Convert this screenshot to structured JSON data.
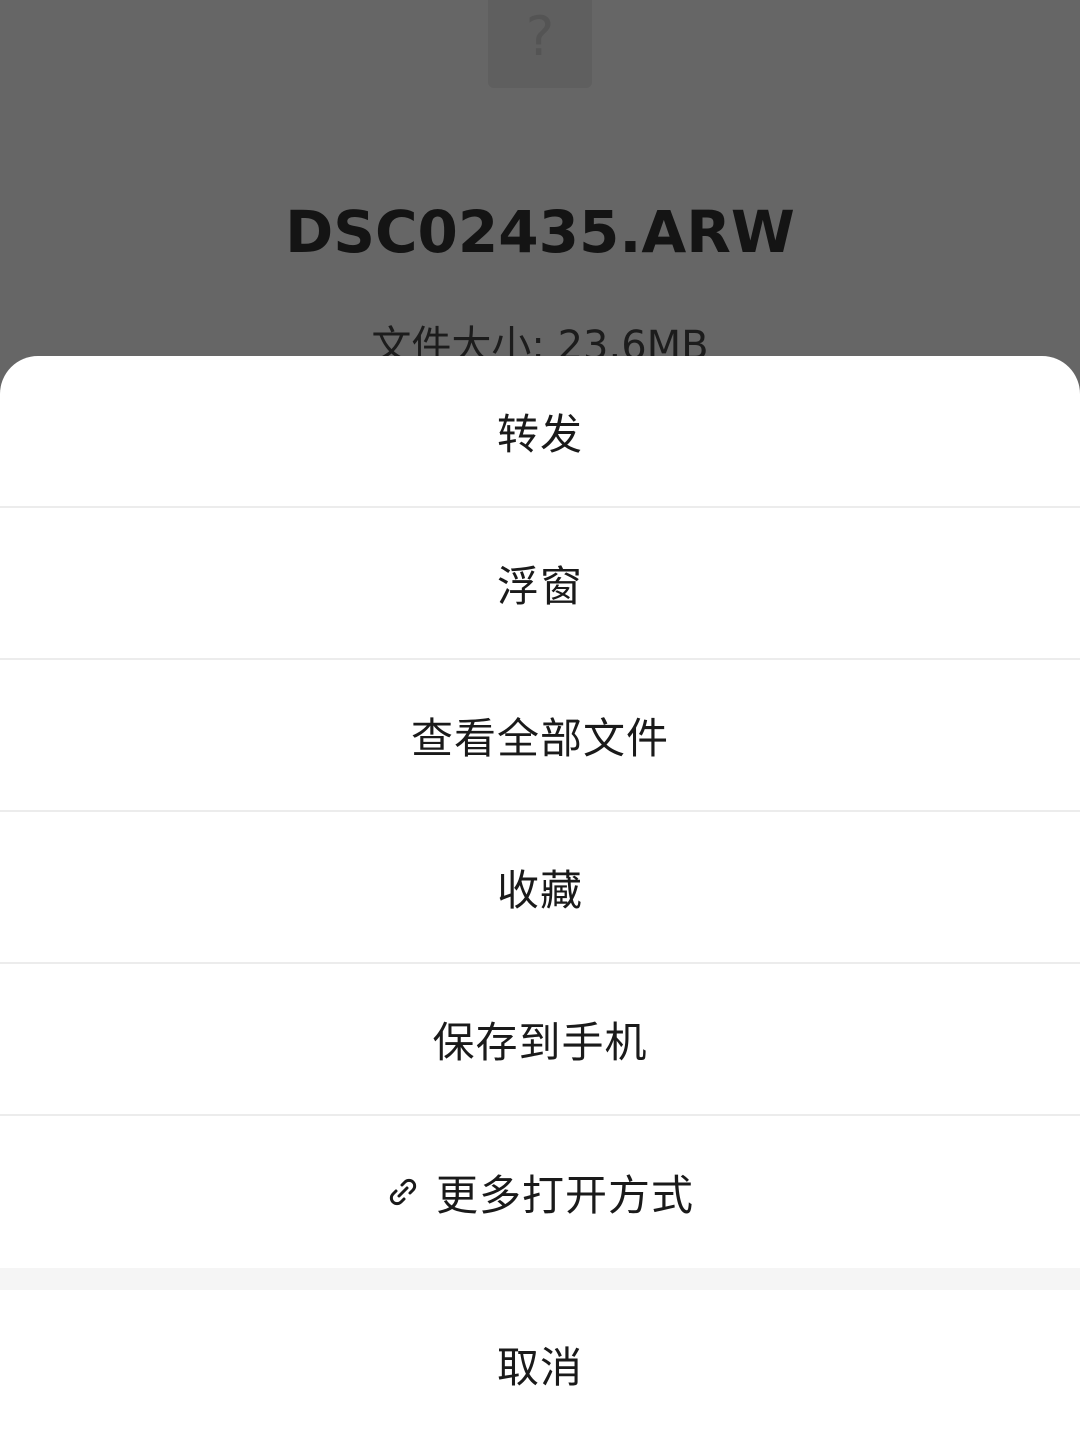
{
  "file": {
    "icon": "unknown-file-icon",
    "icon_glyph": "?",
    "name": "DSC02435.ARW",
    "size_text": "文件大小: 23.6MB"
  },
  "sheet": {
    "actions": [
      {
        "label": "转发"
      },
      {
        "label": "浮窗"
      },
      {
        "label": "查看全部文件"
      },
      {
        "label": "收藏"
      },
      {
        "label": "保存到手机"
      },
      {
        "label": "更多打开方式",
        "icon": "link-icon"
      }
    ],
    "cancel_label": "取消"
  },
  "colors": {
    "overlay": "#666666",
    "sheet_background": "#ffffff",
    "divider": "#ececec",
    "text": "#1a1a1a"
  }
}
